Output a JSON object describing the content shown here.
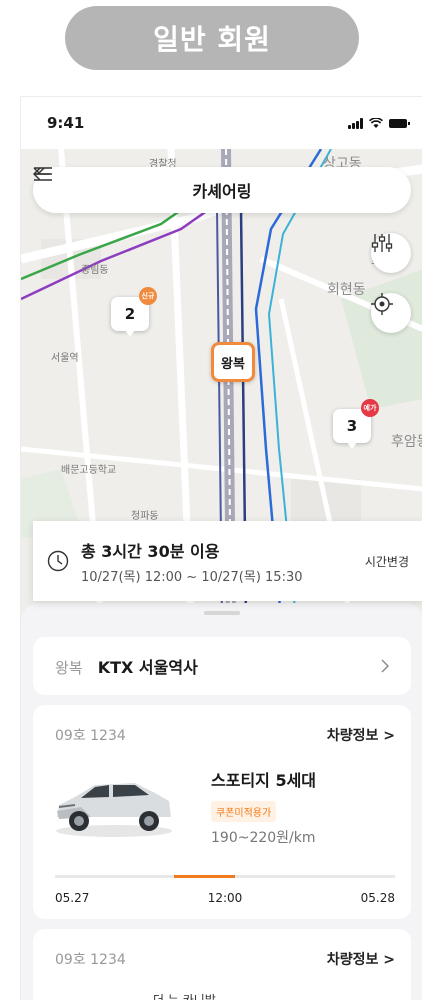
{
  "top_label": "일반 회원",
  "status": {
    "time": "9:41"
  },
  "header": {
    "title": "카셰어링"
  },
  "map": {
    "labels": [
      "경찰청",
      "상고동",
      "중림동",
      "회현동",
      "서울역",
      "배문고등학교",
      "후암동",
      "청파동",
      "회현"
    ],
    "clusters": [
      {
        "count": "2",
        "badge": "신규",
        "badge_color": "#f08a3c"
      },
      {
        "count": "3",
        "badge": "예가",
        "badge_color": "#e53945"
      }
    ],
    "station_pin": "왕복"
  },
  "time_card": {
    "total": "총 3시간 30분 이용",
    "range": "10/27(목) 12:00 ~ 10/27(목) 15:30",
    "change_label": "시간변경"
  },
  "station": {
    "type_label": "왕복",
    "name": "KTX 서울역사"
  },
  "cars": [
    {
      "plate": "09호 1234",
      "info_label": "차량정보 >",
      "model": "스포티지 5세대",
      "coupon": "쿠폰미적용가",
      "price": "190~220원/km",
      "timeline": {
        "start": "05.27",
        "mid": "12:00",
        "end": "05.28",
        "fill_start": 0.35,
        "fill_end": 0.53
      }
    },
    {
      "plate": "09호 1234",
      "info_label": "차량정보 >",
      "peek": "더 뉴 카니발"
    }
  ],
  "colors": {
    "accent": "#f08a3c",
    "pill": "#b5b5b5"
  }
}
